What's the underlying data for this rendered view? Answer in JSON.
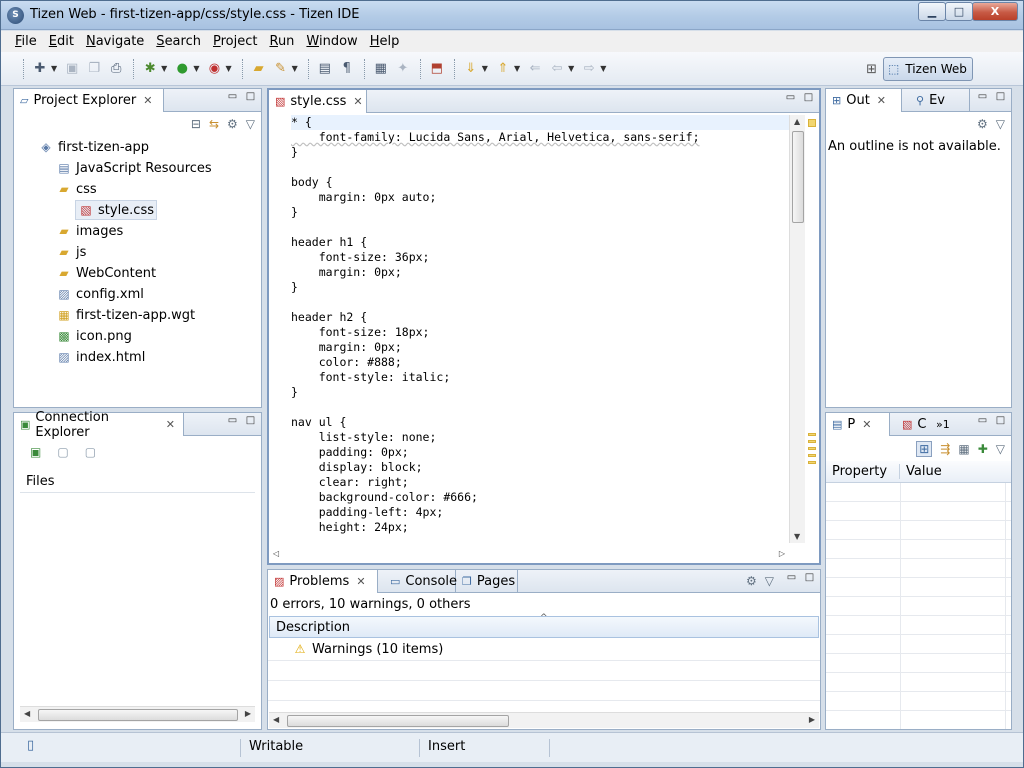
{
  "window": {
    "title": "Tizen Web - first-tizen-app/css/style.css - Tizen IDE",
    "minimize": "▁",
    "maximize": "□",
    "close": "X"
  },
  "menu": [
    {
      "u": "F",
      "rest": "ile"
    },
    {
      "u": "E",
      "rest": "dit"
    },
    {
      "u": "N",
      "rest": "avigate"
    },
    {
      "u": "S",
      "rest": "earch"
    },
    {
      "u": "P",
      "rest": "roject"
    },
    {
      "u": "R",
      "rest": "un"
    },
    {
      "u": "W",
      "rest": "indow"
    },
    {
      "u": "H",
      "rest": "elp"
    }
  ],
  "perspective": {
    "label": "Tizen Web"
  },
  "project_explorer": {
    "title": "Project Explorer",
    "items": [
      {
        "label": "first-tizen-app",
        "icon": "project-icon"
      },
      {
        "label": "JavaScript Resources",
        "icon": "js-resources-icon"
      },
      {
        "label": "css",
        "icon": "folder-open-icon"
      },
      {
        "label": "style.css",
        "icon": "css-file-icon"
      },
      {
        "label": "images",
        "icon": "folder-icon"
      },
      {
        "label": "js",
        "icon": "folder-icon"
      },
      {
        "label": "WebContent",
        "icon": "folder-icon"
      },
      {
        "label": "config.xml",
        "icon": "xml-file-icon"
      },
      {
        "label": "first-tizen-app.wgt",
        "icon": "widget-file-icon"
      },
      {
        "label": "icon.png",
        "icon": "png-file-icon"
      },
      {
        "label": "index.html",
        "icon": "html-file-icon"
      }
    ]
  },
  "connection_explorer": {
    "title": "Connection Explorer",
    "files_header": "Files"
  },
  "editor": {
    "tab_label": "style.css",
    "lines": [
      "* {",
      "    font-family: Lucida Sans, Arial, Helvetica, sans-serif;",
      "}",
      "",
      "body {",
      "    margin: 0px auto;",
      "}",
      "",
      "header h1 {",
      "    font-size: 36px;",
      "    margin: 0px;",
      "}",
      "",
      "header h2 {",
      "    font-size: 18px;",
      "    margin: 0px;",
      "    color: #888;",
      "    font-style: italic;",
      "}",
      "",
      "nav ul {",
      "    list-style: none;",
      "    padding: 0px;",
      "    display: block;",
      "    clear: right;",
      "    background-color: #666;",
      "    padding-left: 4px;",
      "    height: 24px;",
      "}"
    ]
  },
  "outline": {
    "tab_out": "Out",
    "tab_ev": "Ev",
    "message": "An outline is not available."
  },
  "properties": {
    "tab_p": "P",
    "tab_c": "C",
    "overflow": "»1",
    "col_property": "Property",
    "col_value": "Value"
  },
  "problems": {
    "tab_problems": "Problems",
    "tab_console": "Console",
    "tab_pages": "Pages",
    "summary": "0 errors, 10 warnings, 0 others",
    "col_description": "Description",
    "warnings_row": "Warnings (10 items)"
  },
  "status": {
    "writable": "Writable",
    "insert": "Insert"
  }
}
